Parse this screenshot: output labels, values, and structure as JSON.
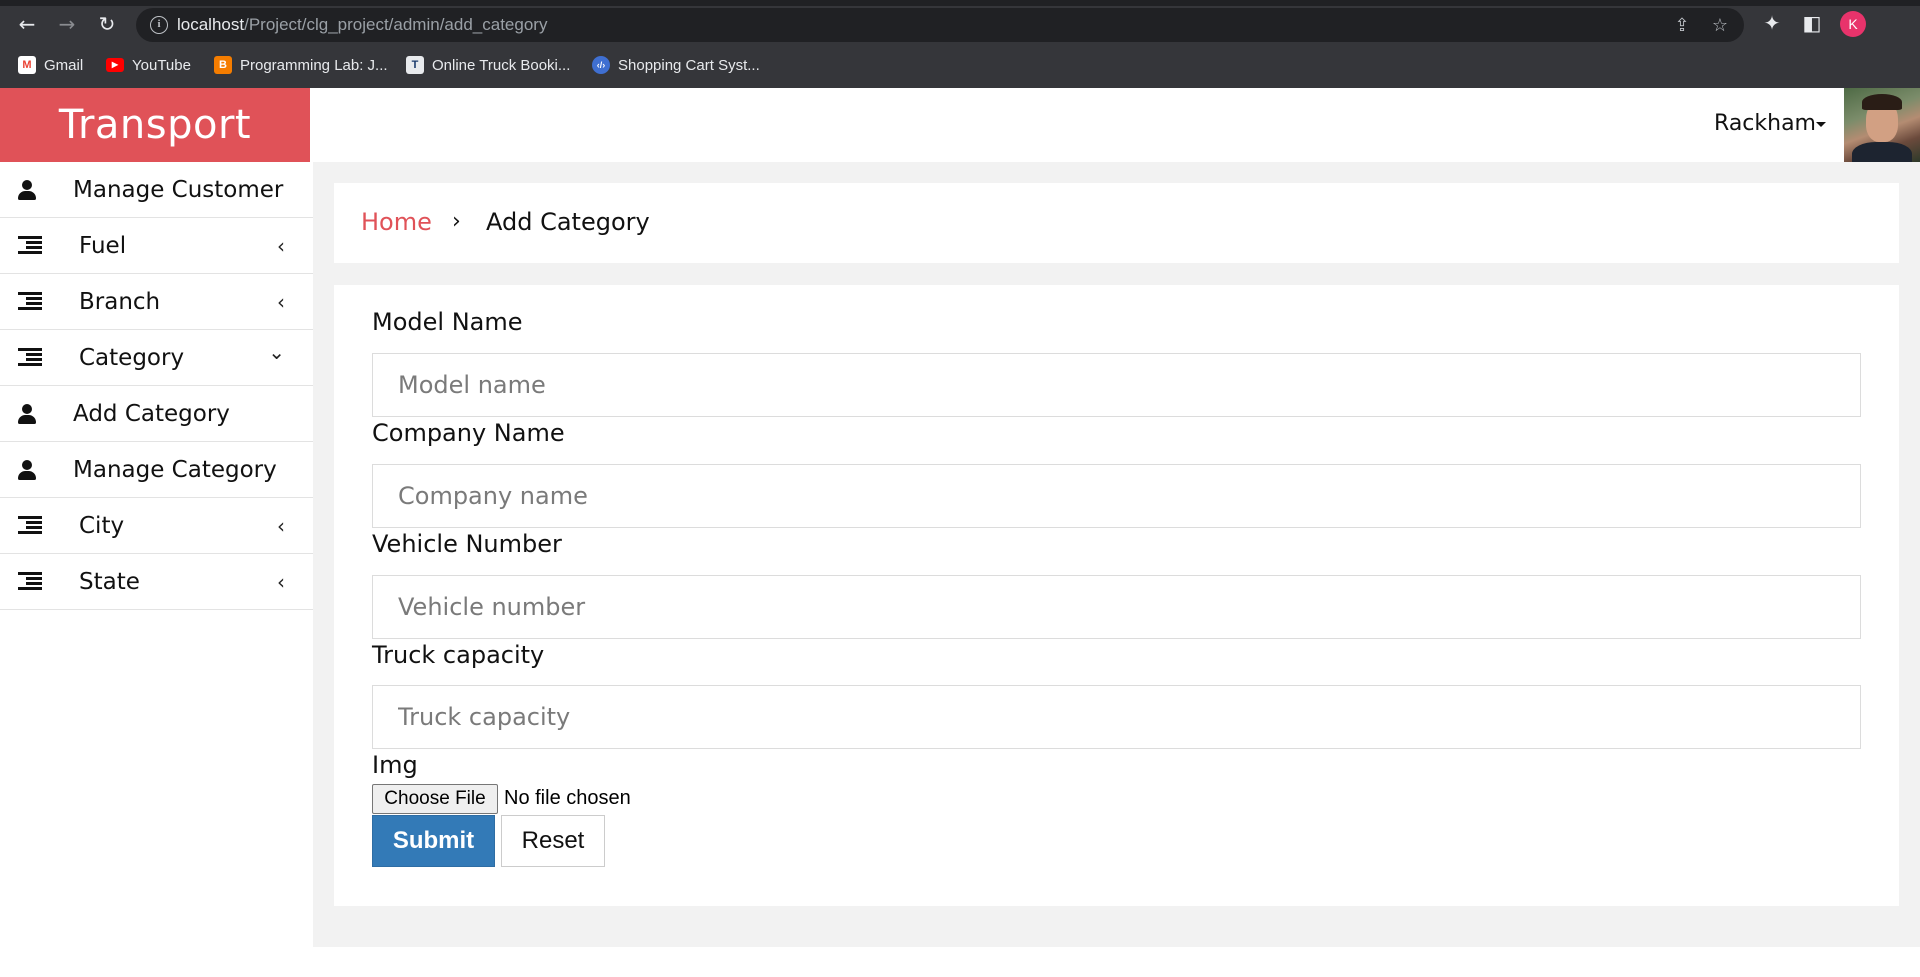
{
  "browser": {
    "url_host": "localhost",
    "url_path": "/Project/clg_project/admin/add_category",
    "profile_initial": "K",
    "bookmarks": [
      {
        "label": "Gmail",
        "icon": "gmail-icon"
      },
      {
        "label": "YouTube",
        "icon": "youtube-icon"
      },
      {
        "label": "Programming Lab: J...",
        "icon": "blogger-icon"
      },
      {
        "label": "Online Truck Booki...",
        "icon": "truck-site-icon"
      },
      {
        "label": "Shopping Cart Syst...",
        "icon": "code-icon"
      }
    ]
  },
  "app": {
    "brand": "Transport",
    "user_name": "Rackham"
  },
  "sidebar": {
    "items": [
      {
        "label": "Manage Customer",
        "icon": "user-icon"
      },
      {
        "label": "Fuel",
        "icon": "list-icon",
        "chevron": "‹"
      },
      {
        "label": "Branch",
        "icon": "list-icon",
        "chevron": "‹"
      },
      {
        "label": "Category",
        "icon": "list-icon",
        "chevron": "⌄"
      },
      {
        "label": "Add Category",
        "icon": "user-icon"
      },
      {
        "label": "Manage Category",
        "icon": "user-icon"
      },
      {
        "label": "City",
        "icon": "list-icon",
        "chevron": "‹"
      },
      {
        "label": "State",
        "icon": "list-icon",
        "chevron": "‹"
      }
    ]
  },
  "breadcrumb": {
    "home": "Home",
    "separator": "›",
    "current": "Add Category"
  },
  "form": {
    "fields": [
      {
        "label": "Model Name",
        "placeholder": "Model name",
        "value": ""
      },
      {
        "label": "Company Name",
        "placeholder": "Company name",
        "value": ""
      },
      {
        "label": "Vehicle Number",
        "placeholder": "Vehicle number",
        "value": ""
      },
      {
        "label": "Truck capacity",
        "placeholder": "Truck capacity",
        "value": ""
      }
    ],
    "img_label": "Img",
    "file_button": "Choose File",
    "file_status": "No file chosen",
    "submit_label": "Submit",
    "reset_label": "Reset"
  },
  "colors": {
    "brand": "#e05258",
    "primary_button": "#337ab7",
    "content_bg": "#f2f2f2"
  }
}
